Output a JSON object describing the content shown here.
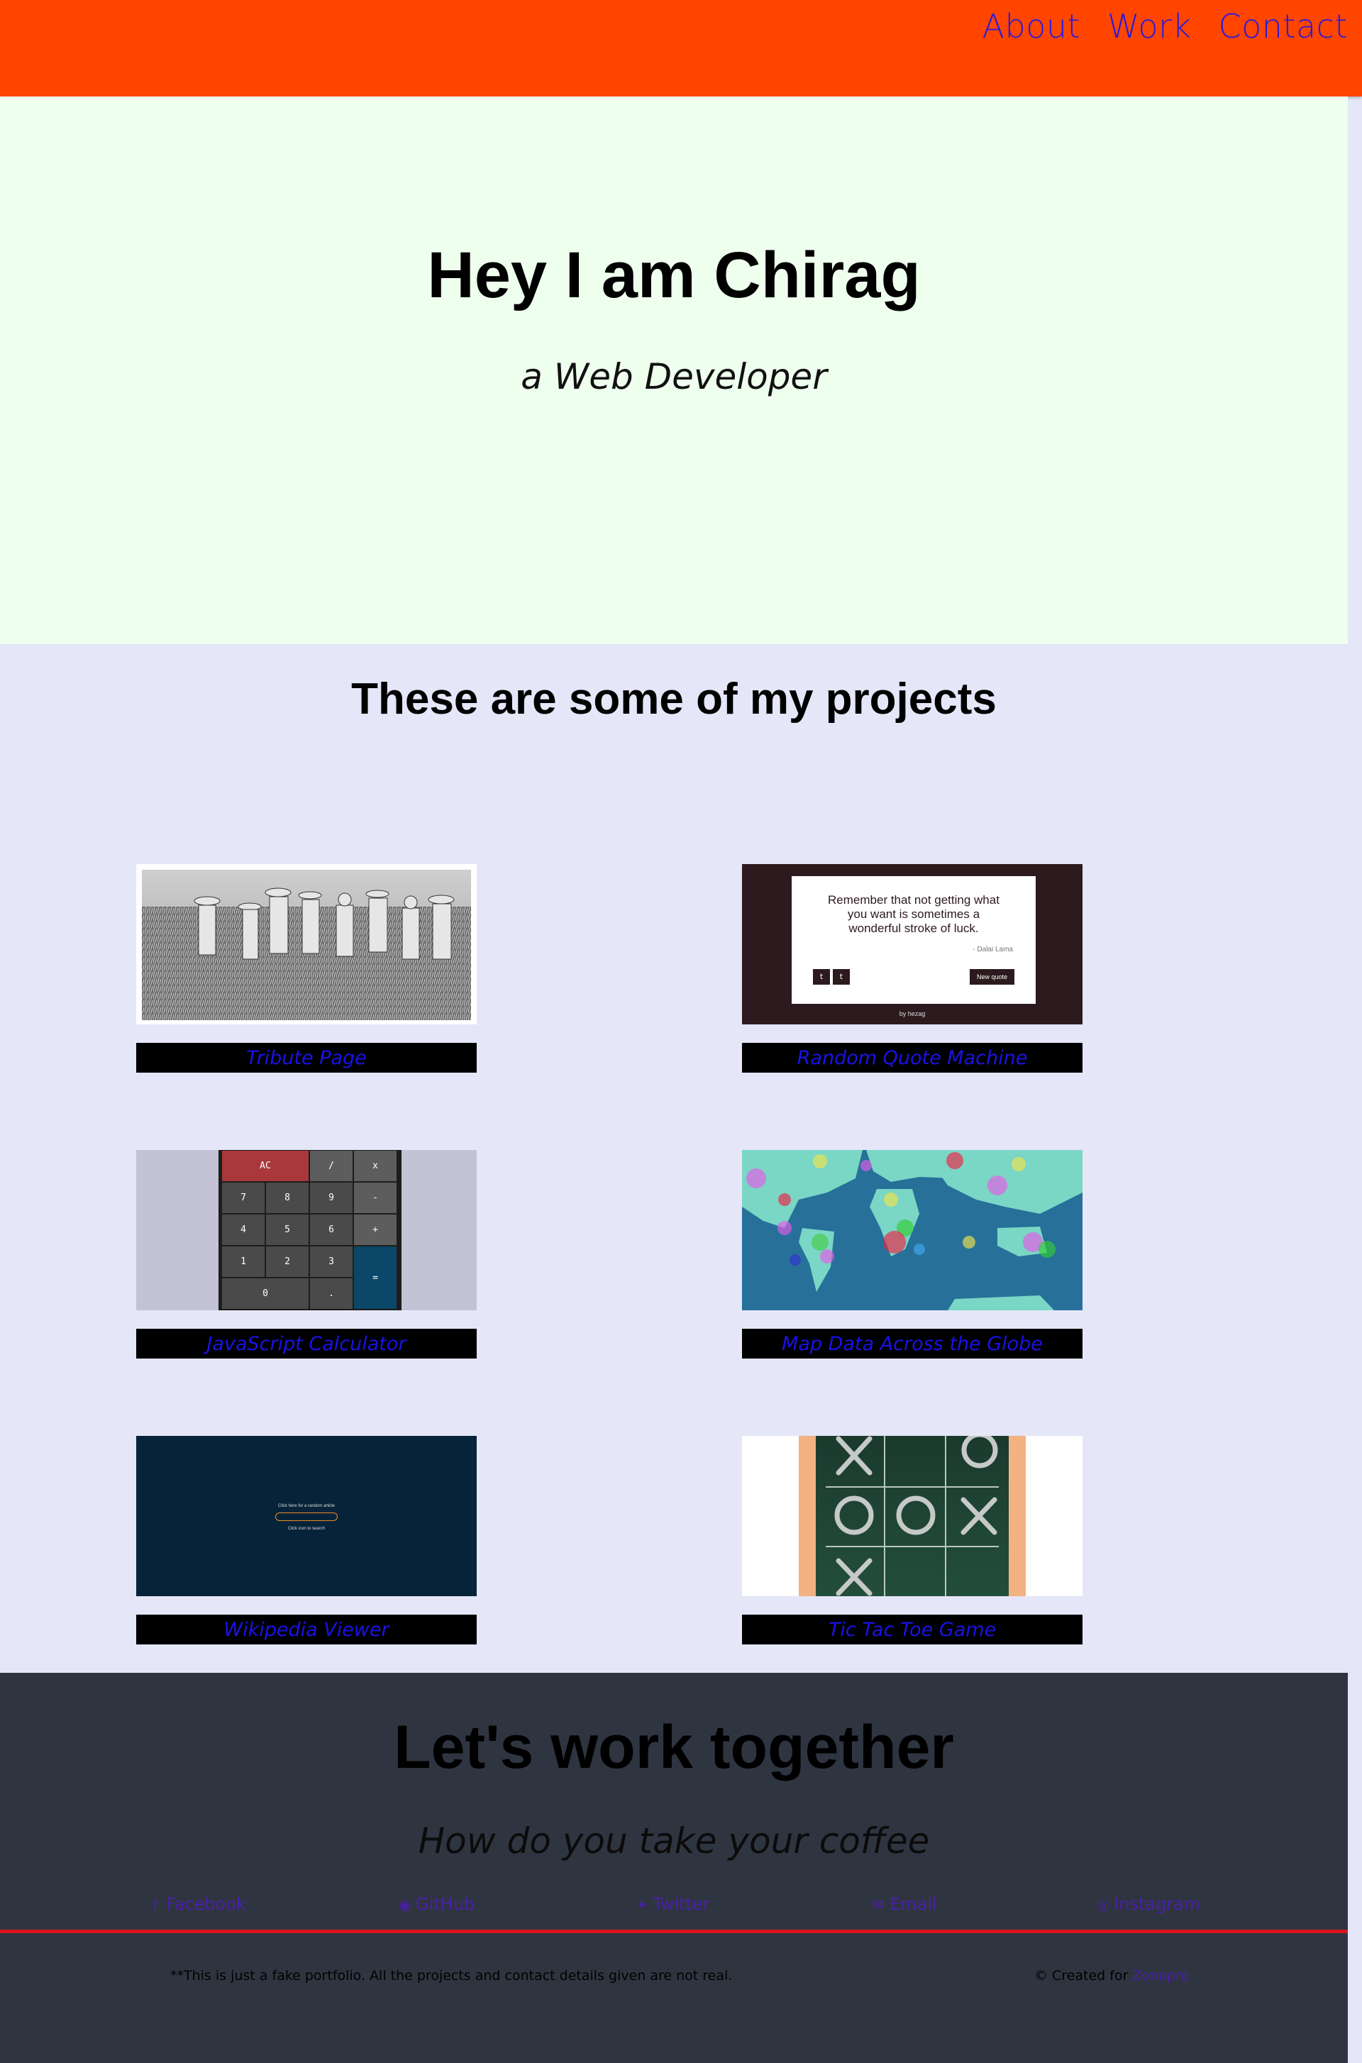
{
  "nav": {
    "items": [
      {
        "label": "About"
      },
      {
        "label": "Work"
      },
      {
        "label": "Contact"
      }
    ]
  },
  "hero": {
    "title": "Hey I am Chirag",
    "subtitle": "a Web Developer"
  },
  "projects": {
    "heading": "These are some of my projects",
    "items": [
      {
        "label": "Tribute Page"
      },
      {
        "label": "Random Quote Machine"
      },
      {
        "label": "JavaScript Calculator"
      },
      {
        "label": "Map Data Across the Globe"
      },
      {
        "label": "Wikipedia Viewer"
      },
      {
        "label": "Tic Tac Toe Game"
      }
    ],
    "quote": {
      "text": "Remember that not getting what you want is sometimes a wonderful stroke of luck.",
      "author": "- Dalai Lama",
      "button": "New quote",
      "footer": "by hezag"
    },
    "calculator": {
      "keys": [
        "AC",
        "/",
        "x",
        "7",
        "8",
        "9",
        "-",
        "4",
        "5",
        "6",
        "+",
        "1",
        "2",
        "3",
        "=",
        "0",
        "."
      ]
    },
    "wiki": {
      "line1": "Click here for a random article",
      "line2": "Click icon to search"
    }
  },
  "contact": {
    "title": "Let's work together",
    "subtitle": "How do you take your coffee",
    "links": [
      {
        "label": "Facebook",
        "icon": "facebook-icon"
      },
      {
        "label": "GitHub",
        "icon": "github-icon"
      },
      {
        "label": "Twitter",
        "icon": "twitter-icon"
      },
      {
        "label": "Email",
        "icon": "email-icon"
      },
      {
        "label": "Instagram",
        "icon": "instagram-icon"
      }
    ],
    "disclaimer": "**This is just a fake portfolio. All the projects and contact details given are not real.",
    "credit_prefix": "© Created for",
    "credit_link": "Zonapro"
  },
  "colors": {
    "nav_bg": "#ff4500",
    "hero_bg": "#efffee",
    "projects_bg": "#e5e6f8",
    "contact_bg": "#2f3540",
    "link": "#2b1bd6",
    "divider": "#d9131d"
  }
}
